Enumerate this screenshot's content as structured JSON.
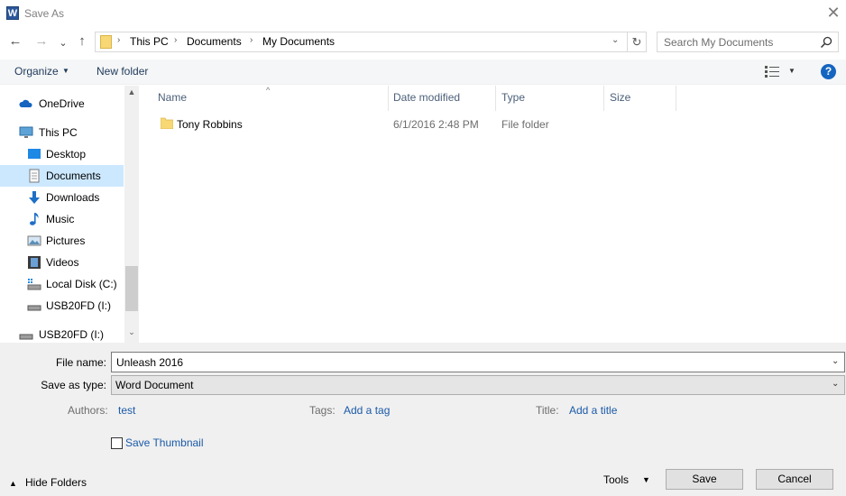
{
  "window": {
    "title": "Save As",
    "app_icon_letter": "W",
    "close_glyph": "✕"
  },
  "nav_buttons": {
    "back": "←",
    "forward": "→",
    "recent": "⌄",
    "up": "↑"
  },
  "address": {
    "crumbs": [
      "This PC",
      "Documents",
      "My Documents"
    ],
    "separator": "›",
    "dropdown": "⌄",
    "refresh": "↻"
  },
  "search": {
    "placeholder": "Search My Documents"
  },
  "toolbar": {
    "organize_label": "Organize",
    "organize_arrow": "▼",
    "new_folder_label": "New folder",
    "view_arrow": "▼",
    "help_label": "?"
  },
  "nav_pane": {
    "items": [
      {
        "label": "OneDrive",
        "icon": "cloud-icon"
      },
      {
        "label": "This PC",
        "icon": "computer-icon"
      },
      {
        "label": "Desktop",
        "icon": "desktop-icon"
      },
      {
        "label": "Documents",
        "icon": "documents-icon",
        "selected": true
      },
      {
        "label": "Downloads",
        "icon": "download-icon"
      },
      {
        "label": "Music",
        "icon": "music-icon"
      },
      {
        "label": "Pictures",
        "icon": "pictures-icon"
      },
      {
        "label": "Videos",
        "icon": "videos-icon"
      },
      {
        "label": "Local Disk (C:)",
        "icon": "drive-icon"
      },
      {
        "label": "USB20FD (I:)",
        "icon": "usb-drive-icon"
      },
      {
        "label": "USB20FD (I:)",
        "icon": "usb-drive-icon"
      }
    ],
    "scroll_up": "▲",
    "scroll_down": "⌄"
  },
  "file_list": {
    "columns": [
      "Name",
      "Date modified",
      "Type",
      "Size"
    ],
    "sort_arrow": "^",
    "rows": [
      {
        "name": "Tony Robbins",
        "date": "6/1/2016 2:48 PM",
        "type": "File folder",
        "size": ""
      }
    ]
  },
  "form": {
    "file_name_label": "File name:",
    "file_name_value": "Unleash 2016",
    "save_type_label": "Save as type:",
    "save_type_value": "Word Document",
    "dropdown_arrow": "⌄",
    "authors_label": "Authors:",
    "authors_value": "test",
    "tags_label": "Tags:",
    "tags_value": "Add a tag",
    "title_label": "Title:",
    "title_value": "Add a title",
    "thumbnail_label": "Save Thumbnail"
  },
  "footer": {
    "hide_folders_arrow": "▲",
    "hide_folders_label": "Hide Folders",
    "tools_label": "Tools",
    "tools_arrow": "▼",
    "save_label": "Save",
    "cancel_label": "Cancel"
  },
  "colors": {
    "accent": "#1a5aa8",
    "selection": "#cce8ff",
    "folder": "#f8d775"
  }
}
